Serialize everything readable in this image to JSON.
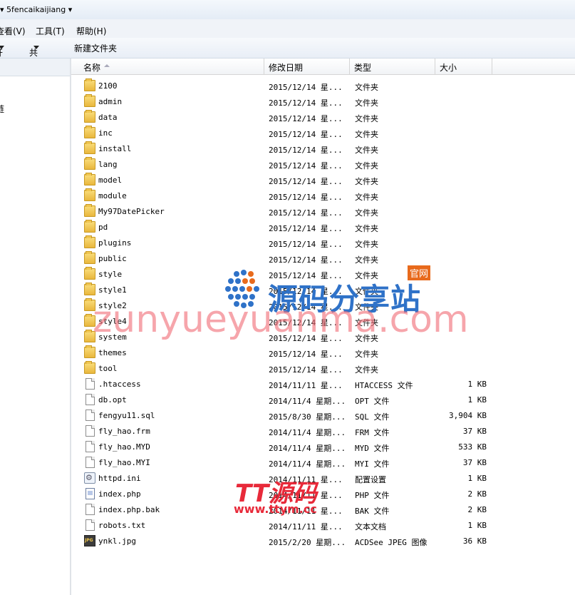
{
  "addressbar": {
    "path": "▾ 5fencaikaijiang ▾"
  },
  "menubar": {
    "view": "查看(V)",
    "tools": "工具(T)",
    "help": "帮助(H)"
  },
  "toolbar": {
    "open_partial": "开",
    "share": "共享",
    "new_folder": "新建文件夹"
  },
  "navpane": {
    "partial_item": "链"
  },
  "columns": {
    "name": "名称",
    "date": "修改日期",
    "type": "类型",
    "size": "大小"
  },
  "files": [
    {
      "name": "2100",
      "date": "2015/12/14 星...",
      "type": "文件夹",
      "size": "",
      "icon": "folder-icon"
    },
    {
      "name": "admin",
      "date": "2015/12/14 星...",
      "type": "文件夹",
      "size": "",
      "icon": "folder-icon"
    },
    {
      "name": "data",
      "date": "2015/12/14 星...",
      "type": "文件夹",
      "size": "",
      "icon": "folder-icon"
    },
    {
      "name": "inc",
      "date": "2015/12/14 星...",
      "type": "文件夹",
      "size": "",
      "icon": "folder-icon"
    },
    {
      "name": "install",
      "date": "2015/12/14 星...",
      "type": "文件夹",
      "size": "",
      "icon": "folder-icon"
    },
    {
      "name": "lang",
      "date": "2015/12/14 星...",
      "type": "文件夹",
      "size": "",
      "icon": "folder-icon"
    },
    {
      "name": "model",
      "date": "2015/12/14 星...",
      "type": "文件夹",
      "size": "",
      "icon": "folder-icon"
    },
    {
      "name": "module",
      "date": "2015/12/14 星...",
      "type": "文件夹",
      "size": "",
      "icon": "folder-icon"
    },
    {
      "name": "My97DatePicker",
      "date": "2015/12/14 星...",
      "type": "文件夹",
      "size": "",
      "icon": "folder-icon"
    },
    {
      "name": "pd",
      "date": "2015/12/14 星...",
      "type": "文件夹",
      "size": "",
      "icon": "folder-icon"
    },
    {
      "name": "plugins",
      "date": "2015/12/14 星...",
      "type": "文件夹",
      "size": "",
      "icon": "folder-icon"
    },
    {
      "name": "public",
      "date": "2015/12/14 星...",
      "type": "文件夹",
      "size": "",
      "icon": "folder-icon"
    },
    {
      "name": "style",
      "date": "2015/12/14 星...",
      "type": "文件夹",
      "size": "",
      "icon": "folder-icon"
    },
    {
      "name": "style1",
      "date": "2015/12/14 星...",
      "type": "文件夹",
      "size": "",
      "icon": "folder-icon"
    },
    {
      "name": "style2",
      "date": "2015/12/14 星...",
      "type": "文件夹",
      "size": "",
      "icon": "folder-icon"
    },
    {
      "name": "style4",
      "date": "2015/12/14 星...",
      "type": "文件夹",
      "size": "",
      "icon": "folder-icon"
    },
    {
      "name": "system",
      "date": "2015/12/14 星...",
      "type": "文件夹",
      "size": "",
      "icon": "folder-icon"
    },
    {
      "name": "themes",
      "date": "2015/12/14 星...",
      "type": "文件夹",
      "size": "",
      "icon": "folder-icon"
    },
    {
      "name": "tool",
      "date": "2015/12/14 星...",
      "type": "文件夹",
      "size": "",
      "icon": "folder-icon"
    },
    {
      "name": ".htaccess",
      "date": "2014/11/11 星...",
      "type": "HTACCESS 文件",
      "size": "1 KB",
      "icon": "file-icon"
    },
    {
      "name": "db.opt",
      "date": "2014/11/4 星期...",
      "type": "OPT 文件",
      "size": "1 KB",
      "icon": "file-icon"
    },
    {
      "name": "fengyu11.sql",
      "date": "2015/8/30 星期...",
      "type": "SQL 文件",
      "size": "3,904 KB",
      "icon": "file-icon"
    },
    {
      "name": "fly_hao.frm",
      "date": "2014/11/4 星期...",
      "type": "FRM 文件",
      "size": "37 KB",
      "icon": "file-icon"
    },
    {
      "name": "fly_hao.MYD",
      "date": "2014/11/4 星期...",
      "type": "MYD 文件",
      "size": "533 KB",
      "icon": "file-icon"
    },
    {
      "name": "fly_hao.MYI",
      "date": "2014/11/4 星期...",
      "type": "MYI 文件",
      "size": "37 KB",
      "icon": "file-icon"
    },
    {
      "name": "httpd.ini",
      "date": "2014/11/11 星...",
      "type": "配置设置",
      "size": "1 KB",
      "icon": "settings-file-icon"
    },
    {
      "name": "index.php",
      "date": "2014/11/11 星...",
      "type": "PHP 文件",
      "size": "2 KB",
      "icon": "php-file-icon"
    },
    {
      "name": "index.php.bak",
      "date": "2014/11/11 星...",
      "type": "BAK 文件",
      "size": "2 KB",
      "icon": "file-icon"
    },
    {
      "name": "robots.txt",
      "date": "2014/11/11 星...",
      "type": "文本文档",
      "size": "1 KB",
      "icon": "file-icon"
    },
    {
      "name": "ynkl.jpg",
      "date": "2015/2/20 星期...",
      "type": "ACDSee JPEG 图像",
      "size": "36 KB",
      "icon": "image-file-icon"
    }
  ],
  "watermarks": {
    "brand_cn": "源码分享站",
    "brand_tag": "官网",
    "brand_url": "zunyueyuanma.com",
    "tt_logo": "TT源码",
    "tt_url": "www.ttym.cc"
  }
}
